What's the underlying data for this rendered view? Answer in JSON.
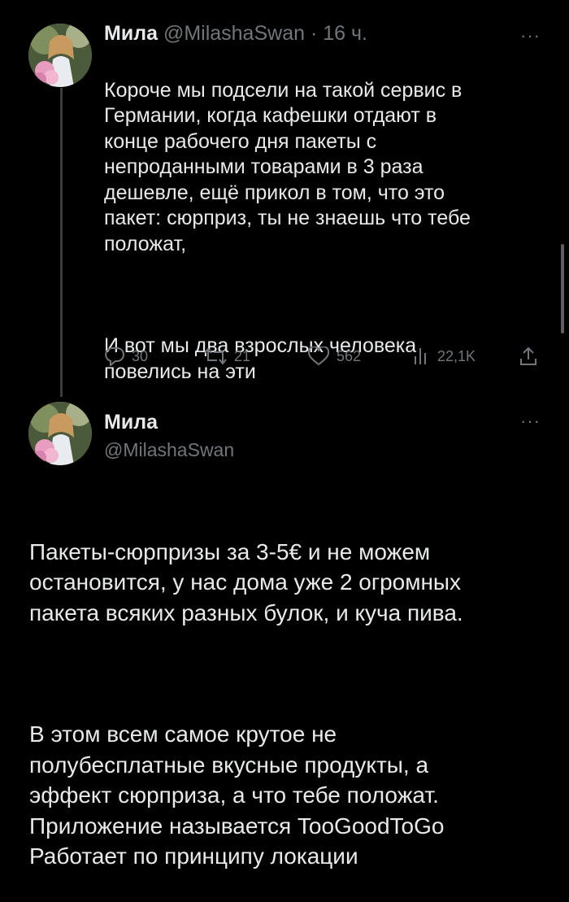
{
  "tweet1": {
    "author_name": "Мила",
    "handle": "@MilashaSwan",
    "separator": "·",
    "time": "16 ч.",
    "more_label": "···",
    "paragraph1": "Короче мы подсели на такой сервис в\nГермании, когда кафешки отдают в\nконце рабочего дня пакеты с\nнепроданными товарами в 3 раза\nдешевле, ещё прикол в том, что это\nпакет: сюрприз, ты не знаешь что тебе\nположат,",
    "paragraph2": "И вот мы два взрослых человека\nповелись на эти",
    "actions": {
      "replies": "30",
      "retweets": "21",
      "likes": "562",
      "views": "22,1K"
    }
  },
  "tweet2": {
    "author_name": "Мила",
    "handle": "@MilashaSwan",
    "more_label": "···",
    "paragraph1": "Пакеты-сюрпризы за 3-5€ и не можем\nостановится, у нас дома уже 2 огромных\nпакета всяких разных булок, и куча пива.",
    "paragraph2": "В этом всем самое крутое не\nполубесплатные вкусные продукты, а\nэффект сюрприза, а что тебе положат.\nПриложение называется TooGoodToGo\nРаботает по принципу локации"
  },
  "colors": {
    "background": "#000000",
    "text": "#e7e9ea",
    "secondary": "#71767b",
    "thread_line": "#3a3d40"
  },
  "icons": [
    "reply-icon",
    "retweet-icon",
    "like-icon",
    "views-icon",
    "share-icon",
    "more-icon"
  ]
}
